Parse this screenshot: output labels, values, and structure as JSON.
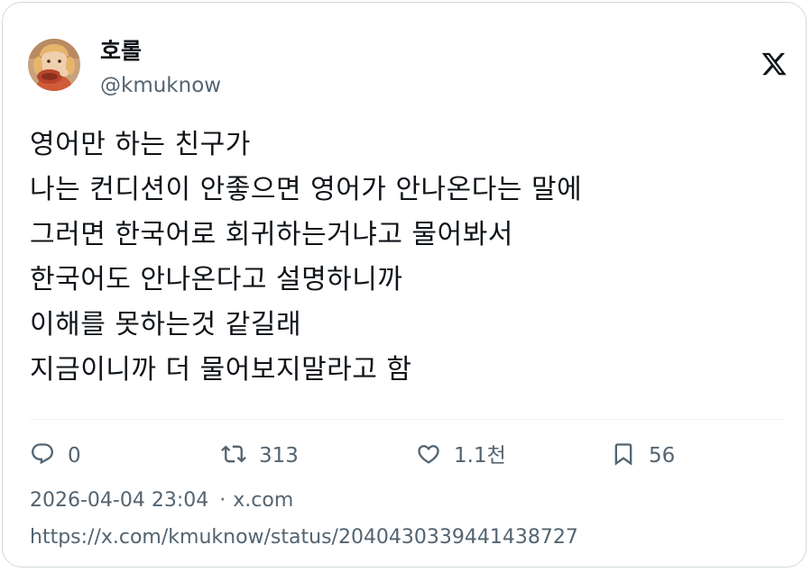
{
  "author": {
    "display_name": "호롤",
    "handle": "@kmuknow",
    "avatar_icon": "profile-photo-avatar"
  },
  "brand_icon": "x-logo-icon",
  "tweet": {
    "lines": [
      "영어만 하는 친구가",
      "나는 컨디션이 안좋으면 영어가 안나온다는 말에",
      "그러면 한국어로 회귀하는거냐고 물어봐서",
      "한국어도 안나온다고 설명하니까",
      "이해를 못하는것 같길래",
      "지금이니까 더 물어보지말라고 함"
    ]
  },
  "actions": {
    "reply": {
      "icon": "reply-icon",
      "count": "0"
    },
    "retweet": {
      "icon": "retweet-icon",
      "count": "313"
    },
    "like": {
      "icon": "heart-icon",
      "count": "1.1천"
    },
    "bookmark": {
      "icon": "bookmark-icon",
      "count": "56"
    }
  },
  "meta": {
    "timestamp": "2026-04-04 23:04",
    "separator": "·",
    "source": "x.com",
    "url": "https://x.com/kmuknow/status/2040430339441438727"
  },
  "colors": {
    "text_primary": "#0f1419",
    "text_secondary": "#536471",
    "border": "#cfd9de",
    "divider": "#eff3f4"
  }
}
